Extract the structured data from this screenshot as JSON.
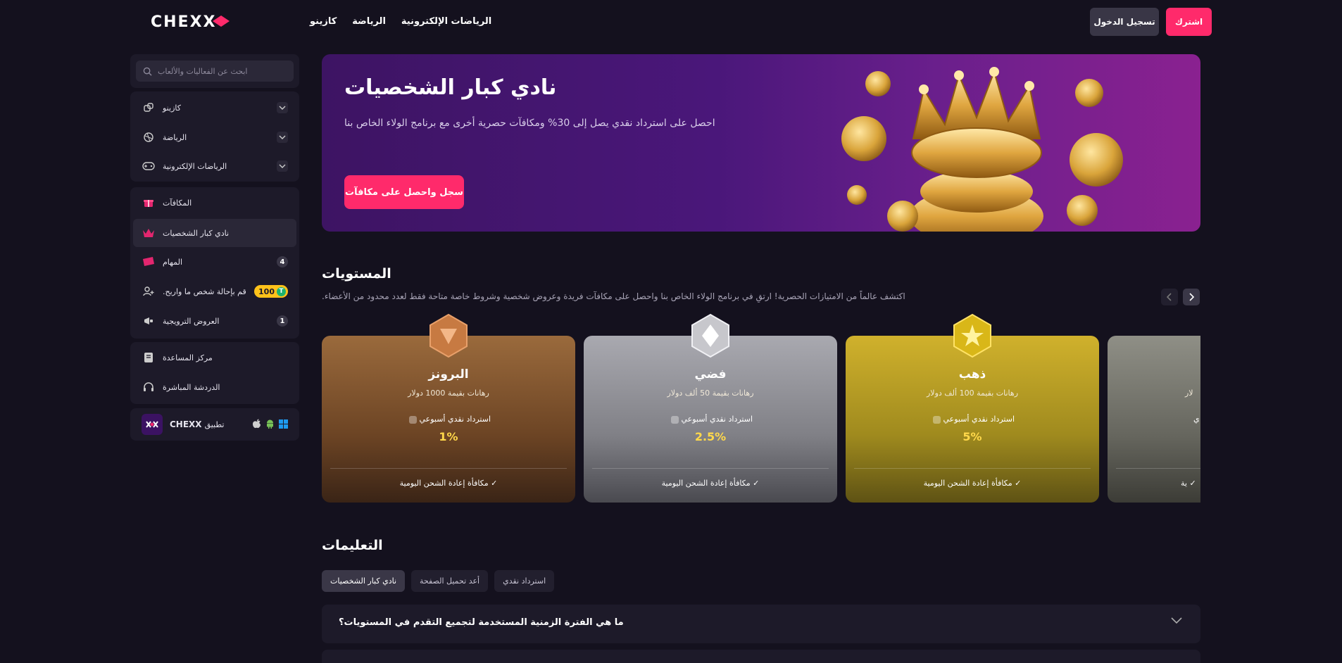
{
  "brand": {
    "name": "CHEXX",
    "accent": "#ff2a6b"
  },
  "topnav": [
    {
      "label": "الرياضات الإلكترونية"
    },
    {
      "label": "الرياضة"
    },
    {
      "label": "كازينو"
    }
  ],
  "auth": {
    "login_label": "تسجيل الدخول",
    "signup_label": "اشترك"
  },
  "sidebar": {
    "search_placeholder": "ابحث عن الفعاليات والألعاب",
    "group1": [
      {
        "label": "كازينو",
        "icon": "dice-icon"
      },
      {
        "label": "الرياضة",
        "icon": "ball-icon"
      },
      {
        "label": "الرياضات الإلكترونية",
        "icon": "gamepad-icon"
      }
    ],
    "group2": [
      {
        "label": "المكافآت",
        "icon": "gift-icon"
      },
      {
        "label": "نادي كبار الشخصيات",
        "icon": "crown-icon"
      },
      {
        "label": "المهام",
        "icon": "ticket-icon",
        "count": "4"
      },
      {
        "label": "قم بإحالة شخص ما واربح.",
        "icon": "add-user-icon",
        "reward": "100",
        "reward_badge": "T"
      },
      {
        "label": "العروض الترويجية",
        "icon": "megaphone-icon",
        "count": "1"
      }
    ],
    "group3": [
      {
        "label": "مركز المساعدة",
        "icon": "book-icon"
      },
      {
        "label": "الدردشة المباشرة",
        "icon": "headset-icon"
      }
    ],
    "app": {
      "label": "تطبيق",
      "name": "CHEXX"
    }
  },
  "hero": {
    "title": "نادي كبار الشخصيات",
    "subtitle": "احصل على استرداد نقدي يصل إلى 30% ومكافآت حصرية أخرى مع برنامج الولاء الخاص بنا",
    "cta": "سجل واحصل على مكافآت"
  },
  "levels": {
    "title": "المستويات",
    "description": "اكتشف عالماً من الامتيازات الحصرية! ارتقِ في برنامج الولاء الخاص بنا واحصل على مكافآت فريدة وعروض شخصية وشروط خاصة متاحة فقط لعدد محدود من الأعضاء.",
    "cards": [
      {
        "name": "البرونز",
        "wager": "رهانات بقيمة 1000 دولار",
        "cashback_label": "استرداد نقدي أسبوعي",
        "cashback": "1%",
        "perk": "مكافأة إعادة الشحن اليومية",
        "color": "#8a5a33"
      },
      {
        "name": "فضي",
        "wager": "رهانات بقيمة 50 ألف دولار",
        "cashback_label": "استرداد نقدي أسبوعي",
        "cashback": "2.5%",
        "perk": "مكافأة إعادة الشحن اليومية",
        "color": "#8e8e96"
      },
      {
        "name": "ذهب",
        "wager": "رهانات بقيمة 100 ألف دولار",
        "cashback_label": "استرداد نقدي أسبوعي",
        "cashback": "5%",
        "perk": "مكافأة إعادة الشحن اليومية",
        "color": "#b59a22"
      },
      {
        "name": "",
        "wager": "لار",
        "cashback_label": "ي",
        "cashback": "",
        "perk": "ية",
        "color": "#6e6e66"
      }
    ]
  },
  "instructions": {
    "title": "التعليمات",
    "tabs": [
      {
        "label": "نادي كبار الشخصيات"
      },
      {
        "label": "أعد تحميل الصفحة"
      },
      {
        "label": "استرداد نقدي"
      }
    ],
    "faq": [
      {
        "question": "ما هي الفترة الزمنية المستخدمة لتجميع التقدم في المستويات؟"
      }
    ]
  }
}
